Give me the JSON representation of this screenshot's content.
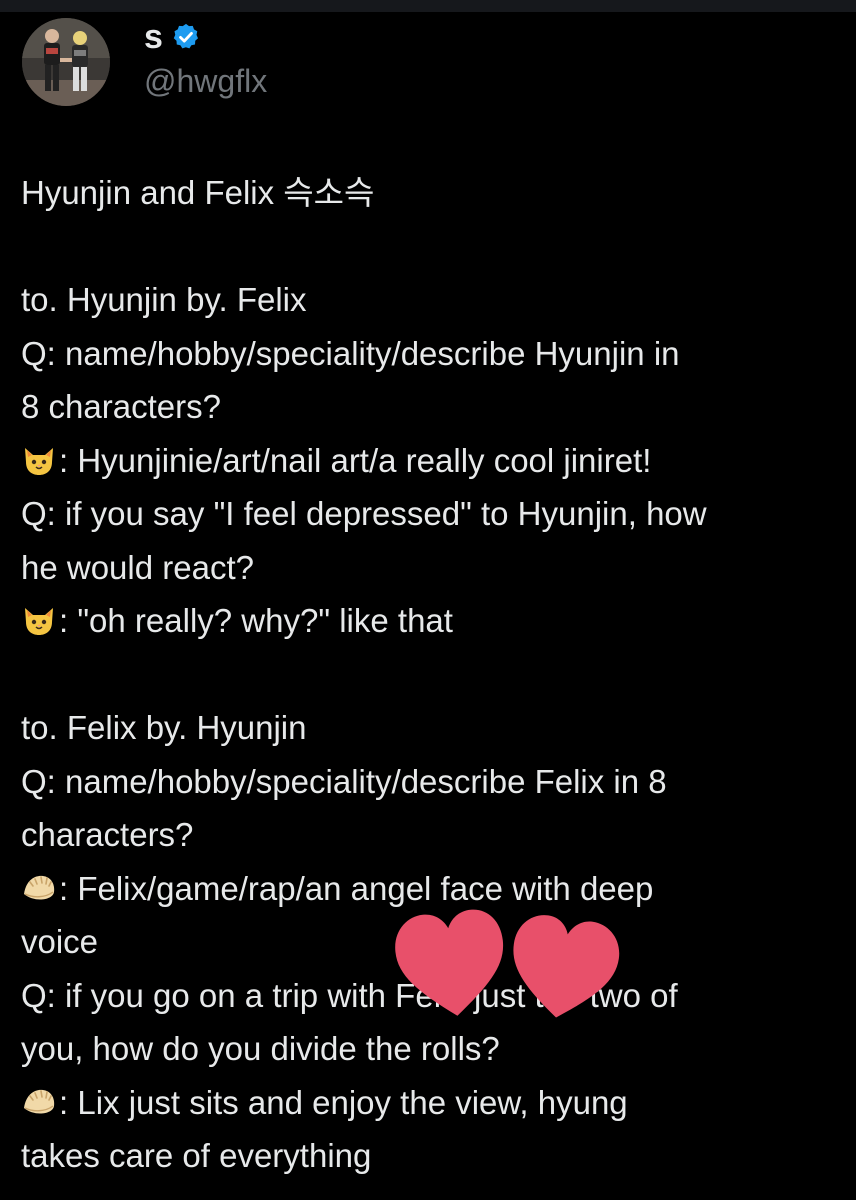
{
  "profile": {
    "display_name": "s",
    "handle": "@hwgflx",
    "verified": true,
    "avatar_icon": "avatar-photo"
  },
  "tweet": {
    "lines": [
      {
        "kind": "text",
        "text": "Hyunjin and Felix 슥소슥"
      },
      {
        "kind": "blank"
      },
      {
        "kind": "text",
        "text": "to. Hyunjin by. Felix"
      },
      {
        "kind": "text",
        "text": "Q: name/hobby/speciality/describe Hyunjin in"
      },
      {
        "kind": "text",
        "text": "8 characters?"
      },
      {
        "kind": "emoji",
        "icon": "cat-face-emoji",
        "text": ": Hyunjinie/art/nail art/a really cool jiniret!"
      },
      {
        "kind": "text",
        "text": "Q: if you say \"I feel depressed\" to Hyunjin, how"
      },
      {
        "kind": "text",
        "text": "he would react?"
      },
      {
        "kind": "emoji",
        "icon": "cat-face-emoji",
        "text": ": \"oh really? why?\" like that"
      },
      {
        "kind": "blank"
      },
      {
        "kind": "text",
        "text": "to. Felix by. Hyunjin"
      },
      {
        "kind": "text",
        "text": "Q: name/hobby/speciality/describe Felix in 8"
      },
      {
        "kind": "text",
        "text": "characters?"
      },
      {
        "kind": "emoji",
        "icon": "dumpling-emoji",
        "text": ": Felix/game/rap/an angel face with deep"
      },
      {
        "kind": "text",
        "text": "voice"
      },
      {
        "kind": "text",
        "text": "Q: if you go on a trip with Felix just the two of"
      },
      {
        "kind": "text",
        "text": "you, how do you divide the rolls?"
      },
      {
        "kind": "emoji",
        "icon": "dumpling-emoji",
        "text": ": Lix just sits and enjoy the view, hyung"
      },
      {
        "kind": "text",
        "text": "takes care of everything"
      }
    ]
  },
  "overlay": {
    "icon": "hearts-sticker-icon",
    "color": "#e8506a"
  },
  "colors": {
    "background": "#000000",
    "text": "#e7e9ea",
    "handle": "#71767b",
    "verified": "#1d9bf0"
  }
}
